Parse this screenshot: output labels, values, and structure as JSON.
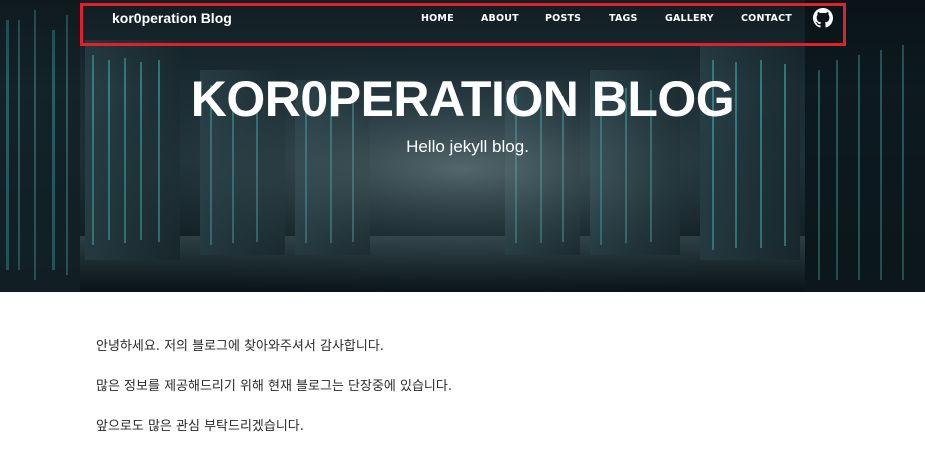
{
  "navbar": {
    "brand": "kor0peration Blog",
    "links": [
      {
        "label": "HOME"
      },
      {
        "label": "ABOUT"
      },
      {
        "label": "POSTS"
      },
      {
        "label": "TAGS"
      },
      {
        "label": "GALLERY"
      },
      {
        "label": "CONTACT"
      }
    ],
    "github_icon": "github-icon"
  },
  "hero": {
    "title": "KOR0PERATION BLOG",
    "subtitle": "Hello jekyll blog."
  },
  "content": {
    "paragraphs": [
      "안녕하세요. 저의 블로그에 찾아와주셔서 감사합니다.",
      "많은 정보를 제공해드리기 위해 현재 블로그는 단장중에 있습니다.",
      "앞으로도 많은 관심 부탁드리겠습니다."
    ]
  },
  "colors": {
    "highlight_border": "#e0202a",
    "hero_text": "#ffffff",
    "body_text": "#2a2a2a"
  }
}
